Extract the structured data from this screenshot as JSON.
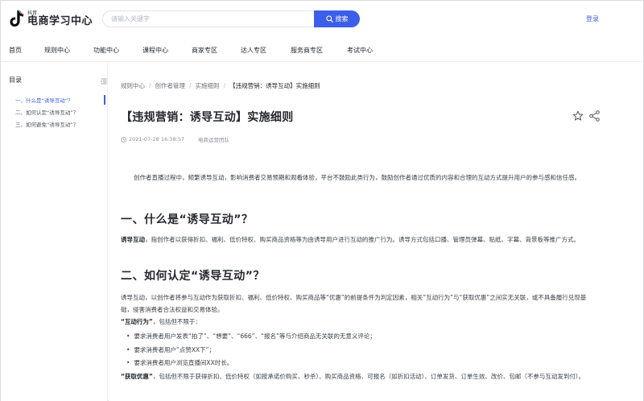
{
  "header": {
    "logo_small": "抖音",
    "logo_title": "电商学习中心",
    "search_placeholder": "请输入关键字",
    "search_button": "搜索",
    "login": "登录"
  },
  "nav": {
    "items": [
      "首页",
      "规则中心",
      "功能中心",
      "课程中心",
      "商家专区",
      "达人专区",
      "服务商专区",
      "考试中心"
    ]
  },
  "toc": {
    "title": "目录",
    "items": [
      "一、什么是“诱导互动”？",
      "二、如何认定“诱导互动”？",
      "三、如何避免“诱导互动”？"
    ]
  },
  "breadcrumb": {
    "items": [
      "规则中心",
      "创作者管理",
      "实施细则",
      "【违规营销：诱导互动】实施细则"
    ]
  },
  "article": {
    "title": "【违规营销：诱导互动】实施细则",
    "datetime": "2021-07-28 16:38:57",
    "author": "电商运营团队",
    "intro": "创作者直播过程中，频繁诱导互动，影响消费者交易预期和观看体验，平台不鼓励此类行为，鼓励创作者通过优质的内容和合理的互动方式提升用户的参与感和信任感。",
    "h1": "一、什么是“诱导互动”？",
    "p1_bold": "诱导互动",
    "p1_rest": "，指创作者以获得折扣、福利、低价特权、购买商品资格等为由诱导用户进行互动的推广行为。诱导方式包括口播、管理员弹幕、贴纸、字幕、背景板等推广方式。",
    "h2": "二、如何认定“诱导互动”？",
    "p2": "诱导互动，以创作者将参与互动作为获取折扣、福利、低价特权、购买商品等“优惠”的前提条件为判定因素，相关“互动行为”与“获取优惠”之间实无关联，或不具备履行兑现基础，侵害消费者合法权益和交易体验。",
    "interact_bold": "“互动行为”",
    "interact_rest": "，包括但不限于：",
    "bullets": [
      "要求消费者用户发表“拍了”、“想要”、“666”、“报名”等与介绍商品无关联的无意义评论；",
      "要求消费者用户“点赞XX下”；",
      "要求消费者用户浏览直播间XX时长。"
    ],
    "benefit_bold": "“获取优惠”",
    "benefit_rest": "，包括但不限于获得折扣、低价特权（如按承诺价购买、秒杀）、购买商品资格、可报名（如折扣活动）、订单发货、订单生效、改价、包邮（不参与互动发到付）。"
  }
}
